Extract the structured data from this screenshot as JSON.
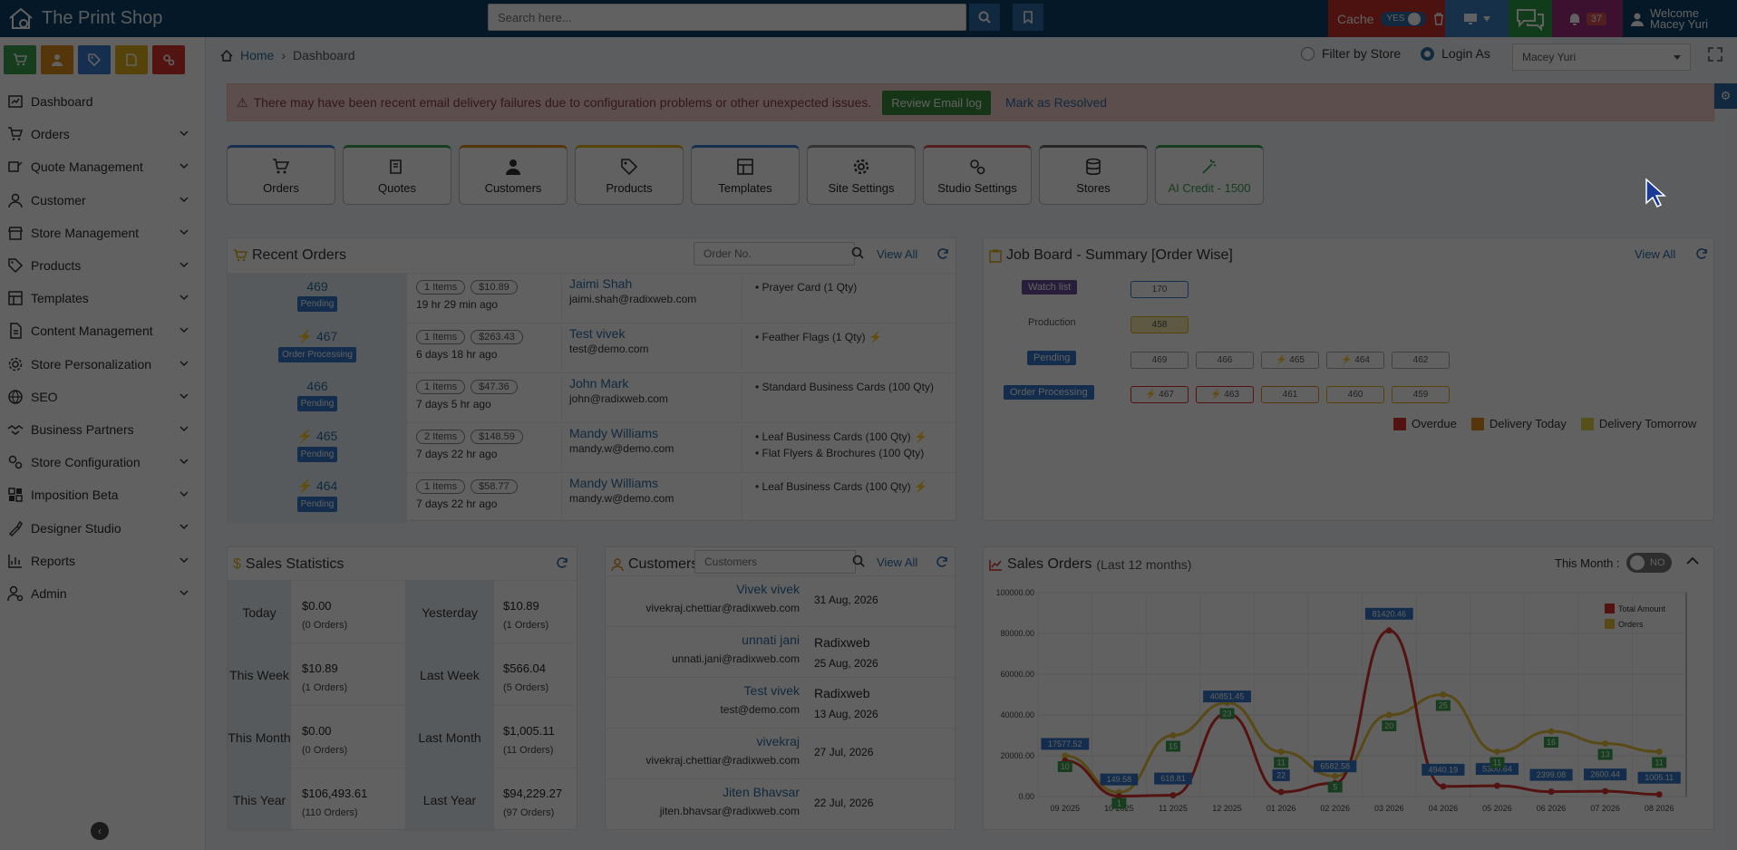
{
  "app": {
    "title": "The Print Shop"
  },
  "header": {
    "search_placeholder": "Search here...",
    "cache_label": "Cache",
    "cache_toggle": "YES",
    "notif_count": "37",
    "welcome_line1": "Welcome",
    "welcome_line2": "Macey Yuri"
  },
  "sidebar": {
    "items": [
      {
        "label": "Dashboard"
      },
      {
        "label": "Orders"
      },
      {
        "label": "Quote Management"
      },
      {
        "label": "Customer"
      },
      {
        "label": "Store Management"
      },
      {
        "label": "Products"
      },
      {
        "label": "Templates"
      },
      {
        "label": "Content Management"
      },
      {
        "label": "Store Personalization"
      },
      {
        "label": "SEO"
      },
      {
        "label": "Business Partners"
      },
      {
        "label": "Store Configuration"
      },
      {
        "label": "Imposition Beta"
      },
      {
        "label": "Designer Studio"
      },
      {
        "label": "Reports"
      },
      {
        "label": "Admin"
      }
    ]
  },
  "breadcrumb": {
    "home": "Home",
    "current": "Dashboard"
  },
  "filters": {
    "filter_by_store": "Filter by Store",
    "login_as": "Login As",
    "login_user": "Macey Yuri"
  },
  "alert": {
    "text": "There may have been recent email delivery failures due to configuration problems or other unexpected issues.",
    "button": "Review Email log",
    "link": "Mark as Resolved"
  },
  "tiles": [
    {
      "label": "Orders",
      "color": "#3b7bd0"
    },
    {
      "label": "Quotes",
      "color": "#3aa14d"
    },
    {
      "label": "Customers",
      "color": "#e08e1b"
    },
    {
      "label": "Products",
      "color": "#e0b11b"
    },
    {
      "label": "Templates",
      "color": "#3b7bd0"
    },
    {
      "label": "Site Settings",
      "color": "#888888"
    },
    {
      "label": "Studio Settings",
      "color": "#d9534f"
    },
    {
      "label": "Stores",
      "color": "#666666"
    },
    {
      "label": "AI Credit - 1500",
      "color": "#3aa14d"
    }
  ],
  "recent_orders": {
    "title": "Recent Orders",
    "search_placeholder": "Order No.",
    "view_all": "View All",
    "rows": [
      {
        "no": "469",
        "status": "Pending",
        "items": "1 Items",
        "amount": "$10.89",
        "ago": "19 hr 29 min ago",
        "name": "Jaimi Shah",
        "email": "jaimi.shah@radixweb.com",
        "products": [
          "Prayer Card (1 Qty)"
        ],
        "rush": false
      },
      {
        "no": "467",
        "status": "Order Processing",
        "items": "1 Items",
        "amount": "$263.43",
        "ago": "6 days 18 hr ago",
        "name": "Test vivek",
        "email": "test@demo.com",
        "products": [
          "Feather Flags (1 Qty)"
        ],
        "rush": true
      },
      {
        "no": "466",
        "status": "Pending",
        "items": "1 Items",
        "amount": "$47.36",
        "ago": "7 days 5 hr ago",
        "name": "John Mark",
        "email": "john@radixweb.com",
        "products": [
          "Standard Business Cards (100 Qty)"
        ],
        "rush": false
      },
      {
        "no": "465",
        "status": "Pending",
        "items": "2 Items",
        "amount": "$148.59",
        "ago": "7 days 22 hr ago",
        "name": "Mandy Williams",
        "email": "mandy.w@demo.com",
        "products": [
          "Leaf Business Cards (100 Qty)",
          "Flat Flyers & Brochures (100 Qty)"
        ],
        "rush": true
      },
      {
        "no": "464",
        "status": "Pending",
        "items": "1 Items",
        "amount": "$58.77",
        "ago": "7 days 22 hr ago",
        "name": "Mandy Williams",
        "email": "mandy.w@demo.com",
        "products": [
          "Leaf Business Cards (100 Qty)"
        ],
        "rush": true
      }
    ]
  },
  "job_board": {
    "title": "Job Board - Summary [Order Wise]",
    "view_all": "View All",
    "rows": [
      {
        "label": "Watch list",
        "boxes": [
          "170"
        ]
      },
      {
        "label": "Production",
        "boxes": [
          "458"
        ]
      },
      {
        "label": "Pending",
        "boxes": [
          "469",
          "466",
          "465",
          "464",
          "462"
        ]
      },
      {
        "label": "Order Processing",
        "boxes": [
          "467",
          "463",
          "461",
          "460",
          "459"
        ]
      }
    ],
    "legend": [
      "Overdue",
      "Delivery Today",
      "Delivery Tomorrow"
    ]
  },
  "sales_stats": {
    "title": "Sales Statistics",
    "rows": [
      {
        "l1": "Today",
        "v1": "$0.00",
        "o1": "(0 Orders)",
        "l2": "Yesterday",
        "v2": "$10.89",
        "o2": "(1 Orders)"
      },
      {
        "l1": "This Week",
        "v1": "$10.89",
        "o1": "(1 Orders)",
        "l2": "Last Week",
        "v2": "$566.04",
        "o2": "(5 Orders)"
      },
      {
        "l1": "This Month",
        "v1": "$0.00",
        "o1": "(0 Orders)",
        "l2": "Last Month",
        "v2": "$1,005.11",
        "o2": "(11 Orders)"
      },
      {
        "l1": "This Year",
        "v1": "$106,493.61",
        "o1": "(110 Orders)",
        "l2": "Last Year",
        "v2": "$94,229.27",
        "o2": "(97 Orders)"
      }
    ]
  },
  "customers": {
    "title": "Customers",
    "search_placeholder": "Customers",
    "view_all": "View All",
    "rows": [
      {
        "name": "Vivek vivek",
        "email": "vivekraj.chettiar@radixweb.com",
        "company": "",
        "date": "31 Aug, 2026"
      },
      {
        "name": "unnati jani",
        "email": "unnati.jani@radixweb.com",
        "company": "Radixweb",
        "date": "25 Aug, 2026"
      },
      {
        "name": "Test vivek",
        "email": "test@demo.com",
        "company": "Radixweb",
        "date": "13 Aug, 2026"
      },
      {
        "name": "vivekraj",
        "email": "vivekraj.chettiar@radixweb.com",
        "company": "",
        "date": "27 Jul, 2026"
      },
      {
        "name": "Jiten Bhavsar",
        "email": "jiten.bhavsar@radixweb.com",
        "company": "",
        "date": "22 Jul, 2026"
      }
    ]
  },
  "sales_orders": {
    "title": "Sales Orders",
    "subtitle": "(Last 12 months)",
    "this_month": "This Month :",
    "toggle": "NO"
  },
  "chart_data": {
    "type": "line",
    "categories": [
      "09 2025",
      "10 2025",
      "11 2025",
      "12 2025",
      "01 2026",
      "02 2026",
      "03 2026",
      "04 2026",
      "05 2026",
      "06 2026",
      "07 2026",
      "08 2026"
    ],
    "series": [
      {
        "name": "Total Amount",
        "values": [
          17577.52,
          149.58,
          618.81,
          40851.45,
          2200,
          6582.58,
          81420.46,
          4940.19,
          5300.64,
          2399.08,
          2600.44,
          1005.11
        ],
        "color": "#d9342b"
      },
      {
        "name": "Orders",
        "values": [
          10,
          1,
          15,
          23,
          11,
          5,
          20,
          25,
          11,
          16,
          13,
          11
        ],
        "color": "#e8c33a"
      }
    ],
    "point_labels": [
      "17577.52",
      "149.58",
      "618.81",
      "40851.45",
      "22",
      "6582.58",
      "81420.46",
      "4940.19",
      "5300.64",
      "2399.08",
      "2600.44",
      "1005.11"
    ],
    "yticks": [
      "0.00",
      "20000.00",
      "40000.00",
      "60000.00",
      "80000.00",
      "100000.00"
    ],
    "ylim": [
      0,
      100000
    ],
    "y2lim": [
      0,
      50
    ],
    "legend": "top-right",
    "grid": true
  }
}
